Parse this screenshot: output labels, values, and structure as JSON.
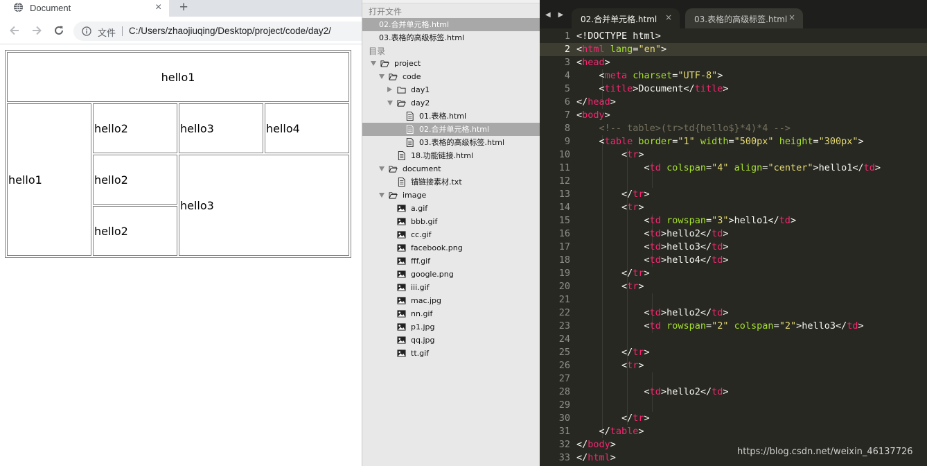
{
  "browser": {
    "tab_title": "Document",
    "tab_close": "×",
    "new_tab": "+",
    "url_label": "文件",
    "url": "C:/Users/zhaojiuqing/Desktop/project/code/day2/",
    "table": {
      "row1": "hello1",
      "row2": [
        "hello1",
        "hello2",
        "hello3",
        "hello4"
      ],
      "row3": [
        "hello2",
        "hello3"
      ],
      "row4": [
        "hello2"
      ]
    }
  },
  "sidebar": {
    "open_files_header": "打开文件",
    "open_files": [
      "02.合并单元格.html",
      "03.表格的高级标签.html"
    ],
    "folders_header": "目录",
    "tree": [
      {
        "label": "project",
        "type": "folder",
        "state": "open"
      },
      {
        "label": "code",
        "type": "folder",
        "state": "open"
      },
      {
        "label": "day1",
        "type": "folder",
        "state": "closed"
      },
      {
        "label": "day2",
        "type": "folder",
        "state": "open"
      },
      {
        "label": "01.表格.html",
        "type": "file"
      },
      {
        "label": "02.合并单元格.html",
        "type": "file",
        "selected": true
      },
      {
        "label": "03.表格的高级标签.html",
        "type": "file"
      },
      {
        "label": "18.功能链接.html",
        "type": "file"
      },
      {
        "label": "document",
        "type": "folder",
        "state": "open"
      },
      {
        "label": "锚链接素材.txt",
        "type": "file"
      },
      {
        "label": "image",
        "type": "folder",
        "state": "open"
      },
      {
        "label": "a.gif",
        "type": "image"
      },
      {
        "label": "bbb.gif",
        "type": "image"
      },
      {
        "label": "cc.gif",
        "type": "image"
      },
      {
        "label": "facebook.png",
        "type": "image"
      },
      {
        "label": "fff.gif",
        "type": "image"
      },
      {
        "label": "google.png",
        "type": "image"
      },
      {
        "label": "iii.gif",
        "type": "image"
      },
      {
        "label": "mac.jpg",
        "type": "image"
      },
      {
        "label": "nn.gif",
        "type": "image"
      },
      {
        "label": "p1.jpg",
        "type": "image"
      },
      {
        "label": "qq.jpg",
        "type": "image"
      },
      {
        "label": "tt.gif",
        "type": "image"
      }
    ]
  },
  "editor": {
    "tabs": [
      {
        "label": "02.合并单元格.html",
        "active": true,
        "close": "×"
      },
      {
        "label": "03.表格的高级标签.html",
        "active": false,
        "close": "×"
      }
    ],
    "nav_arrows": "◀ ▶",
    "current_line": 2,
    "line_numbers": [
      "1",
      "2",
      "3",
      "4",
      "5",
      "6",
      "7",
      "8",
      "9",
      "10",
      "11",
      "12",
      "13",
      "14",
      "15",
      "16",
      "17",
      "18",
      "19",
      "20",
      "21",
      "22",
      "23",
      "24",
      "25",
      "26",
      "27",
      "28",
      "29",
      "30",
      "31",
      "32",
      "33"
    ],
    "code_lines": [
      [
        [
          "p",
          "<!DOCTYPE html>"
        ]
      ],
      [
        [
          "p",
          "<"
        ],
        [
          "t",
          "html"
        ],
        [
          "p",
          " "
        ],
        [
          "a",
          "lang"
        ],
        [
          "p",
          "="
        ],
        [
          "s",
          "\"en\""
        ],
        [
          "p",
          ">"
        ]
      ],
      [
        [
          "p",
          "<"
        ],
        [
          "t",
          "head"
        ],
        [
          "p",
          ">"
        ]
      ],
      [
        [
          "p",
          "    <"
        ],
        [
          "t",
          "meta"
        ],
        [
          "p",
          " "
        ],
        [
          "a",
          "charset"
        ],
        [
          "p",
          "="
        ],
        [
          "s",
          "\"UTF-8\""
        ],
        [
          "p",
          ">"
        ]
      ],
      [
        [
          "p",
          "    <"
        ],
        [
          "t",
          "title"
        ],
        [
          "p",
          ">Document</"
        ],
        [
          "t",
          "title"
        ],
        [
          "p",
          ">"
        ]
      ],
      [
        [
          "p",
          "</"
        ],
        [
          "t",
          "head"
        ],
        [
          "p",
          ">"
        ]
      ],
      [
        [
          "p",
          "<"
        ],
        [
          "t",
          "body"
        ],
        [
          "p",
          ">"
        ]
      ],
      [
        [
          "c",
          "    <!-- table>(tr>td{hello$}*4)*4 -->"
        ]
      ],
      [
        [
          "p",
          "    <"
        ],
        [
          "t",
          "table"
        ],
        [
          "p",
          " "
        ],
        [
          "a",
          "border"
        ],
        [
          "p",
          "="
        ],
        [
          "s",
          "\"1\""
        ],
        [
          "p",
          " "
        ],
        [
          "a",
          "width"
        ],
        [
          "p",
          "="
        ],
        [
          "s",
          "\"500px\""
        ],
        [
          "p",
          " "
        ],
        [
          "a",
          "height"
        ],
        [
          "p",
          "="
        ],
        [
          "s",
          "\"300px\""
        ],
        [
          "p",
          ">"
        ]
      ],
      [
        [
          "p",
          "        <"
        ],
        [
          "t",
          "tr"
        ],
        [
          "p",
          ">"
        ]
      ],
      [
        [
          "p",
          "            <"
        ],
        [
          "t",
          "td"
        ],
        [
          "p",
          " "
        ],
        [
          "a",
          "colspan"
        ],
        [
          "p",
          "="
        ],
        [
          "s",
          "\"4\""
        ],
        [
          "p",
          " "
        ],
        [
          "a",
          "align"
        ],
        [
          "p",
          "="
        ],
        [
          "s",
          "\"center\""
        ],
        [
          "p",
          ">hello1</"
        ],
        [
          "t",
          "td"
        ],
        [
          "p",
          ">"
        ]
      ],
      [],
      [
        [
          "p",
          "        </"
        ],
        [
          "t",
          "tr"
        ],
        [
          "p",
          ">"
        ]
      ],
      [
        [
          "p",
          "        <"
        ],
        [
          "t",
          "tr"
        ],
        [
          "p",
          ">"
        ]
      ],
      [
        [
          "p",
          "            <"
        ],
        [
          "t",
          "td"
        ],
        [
          "p",
          " "
        ],
        [
          "a",
          "rowspan"
        ],
        [
          "p",
          "="
        ],
        [
          "s",
          "\"3\""
        ],
        [
          "p",
          ">hello1</"
        ],
        [
          "t",
          "td"
        ],
        [
          "p",
          ">"
        ]
      ],
      [
        [
          "p",
          "            <"
        ],
        [
          "t",
          "td"
        ],
        [
          "p",
          ">hello2</"
        ],
        [
          "t",
          "td"
        ],
        [
          "p",
          ">"
        ]
      ],
      [
        [
          "p",
          "            <"
        ],
        [
          "t",
          "td"
        ],
        [
          "p",
          ">hello3</"
        ],
        [
          "t",
          "td"
        ],
        [
          "p",
          ">"
        ]
      ],
      [
        [
          "p",
          "            <"
        ],
        [
          "t",
          "td"
        ],
        [
          "p",
          ">hello4</"
        ],
        [
          "t",
          "td"
        ],
        [
          "p",
          ">"
        ]
      ],
      [
        [
          "p",
          "        </"
        ],
        [
          "t",
          "tr"
        ],
        [
          "p",
          ">"
        ]
      ],
      [
        [
          "p",
          "        <"
        ],
        [
          "t",
          "tr"
        ],
        [
          "p",
          ">"
        ]
      ],
      [],
      [
        [
          "p",
          "            <"
        ],
        [
          "t",
          "td"
        ],
        [
          "p",
          ">hello2</"
        ],
        [
          "t",
          "td"
        ],
        [
          "p",
          ">"
        ]
      ],
      [
        [
          "p",
          "            <"
        ],
        [
          "t",
          "td"
        ],
        [
          "p",
          " "
        ],
        [
          "a",
          "rowspan"
        ],
        [
          "p",
          "="
        ],
        [
          "s",
          "\"2\""
        ],
        [
          "p",
          " "
        ],
        [
          "a",
          "colspan"
        ],
        [
          "p",
          "="
        ],
        [
          "s",
          "\"2\""
        ],
        [
          "p",
          ">hello3</"
        ],
        [
          "t",
          "td"
        ],
        [
          "p",
          ">"
        ]
      ],
      [],
      [
        [
          "p",
          "        </"
        ],
        [
          "t",
          "tr"
        ],
        [
          "p",
          ">"
        ]
      ],
      [
        [
          "p",
          "        <"
        ],
        [
          "t",
          "tr"
        ],
        [
          "p",
          ">"
        ]
      ],
      [],
      [
        [
          "p",
          "            <"
        ],
        [
          "t",
          "td"
        ],
        [
          "p",
          ">hello2</"
        ],
        [
          "t",
          "td"
        ],
        [
          "p",
          ">"
        ]
      ],
      [],
      [
        [
          "p",
          "        </"
        ],
        [
          "t",
          "tr"
        ],
        [
          "p",
          ">"
        ]
      ],
      [
        [
          "p",
          "    </"
        ],
        [
          "t",
          "table"
        ],
        [
          "p",
          ">"
        ]
      ],
      [
        [
          "p",
          "</"
        ],
        [
          "t",
          "body"
        ],
        [
          "p",
          ">"
        ]
      ],
      [
        [
          "p",
          "</"
        ],
        [
          "t",
          "html"
        ],
        [
          "p",
          ">"
        ]
      ]
    ],
    "watermark": "https://blog.csdn.net/weixin_46137726"
  },
  "colors": {
    "editor_bg": "#272822",
    "tag": "#f92672",
    "attr": "#a6e22e",
    "string": "#e6db74",
    "comment": "#75715e",
    "sidebar_bg": "#e8e8e8",
    "selection": "#a8a8a8"
  }
}
